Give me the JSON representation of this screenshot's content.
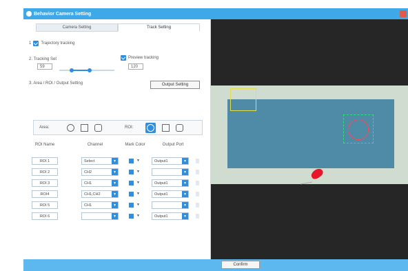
{
  "window": {
    "title": "Behavior Camera Setting"
  },
  "tabs": [
    {
      "label": "Camera Setting",
      "active": false
    },
    {
      "label": "Track Setting",
      "active": true
    }
  ],
  "trajectory": {
    "index": "1",
    "label": "Trajectory tracking",
    "checked": true
  },
  "tracking": {
    "label": "2. Tracking Set",
    "min_value": "59",
    "max_value": "120",
    "preview_label": "Preview tracking",
    "preview_checked": true,
    "slider_fraction": [
      0.22,
      0.55
    ]
  },
  "section3": {
    "label": "3. Area / ROI / Output Setting",
    "output_button": "Output Setting"
  },
  "shape_bar": {
    "area_label": "Area:",
    "roi_label": "ROI:"
  },
  "roi_table": {
    "headers": [
      "ROI Name",
      "Channel",
      "Mark Color",
      "Output Port"
    ],
    "rows": [
      {
        "name": "ROI 1",
        "channel": "Select",
        "output": "Output1"
      },
      {
        "name": "ROI 2",
        "channel": "CH2",
        "output": ""
      },
      {
        "name": "ROI 3",
        "channel": "CH1",
        "output": "Output1"
      },
      {
        "name": "ROI4",
        "channel": "CH1,CH2",
        "output": "Output1"
      },
      {
        "name": "ROI 5",
        "channel": "CH1",
        "output": ""
      },
      {
        "name": "ROI 6",
        "channel": "",
        "output": "Output1"
      }
    ]
  },
  "footer": {
    "confirm_label": "Confirm"
  },
  "colors": {
    "accent": "#2e8fe0",
    "titlebar": "#3fa8e8",
    "arena": "#4f8aa6",
    "roi_yellow": "#e5e04a",
    "roi_green": "#2de07a",
    "mouse": "#e8162a"
  }
}
